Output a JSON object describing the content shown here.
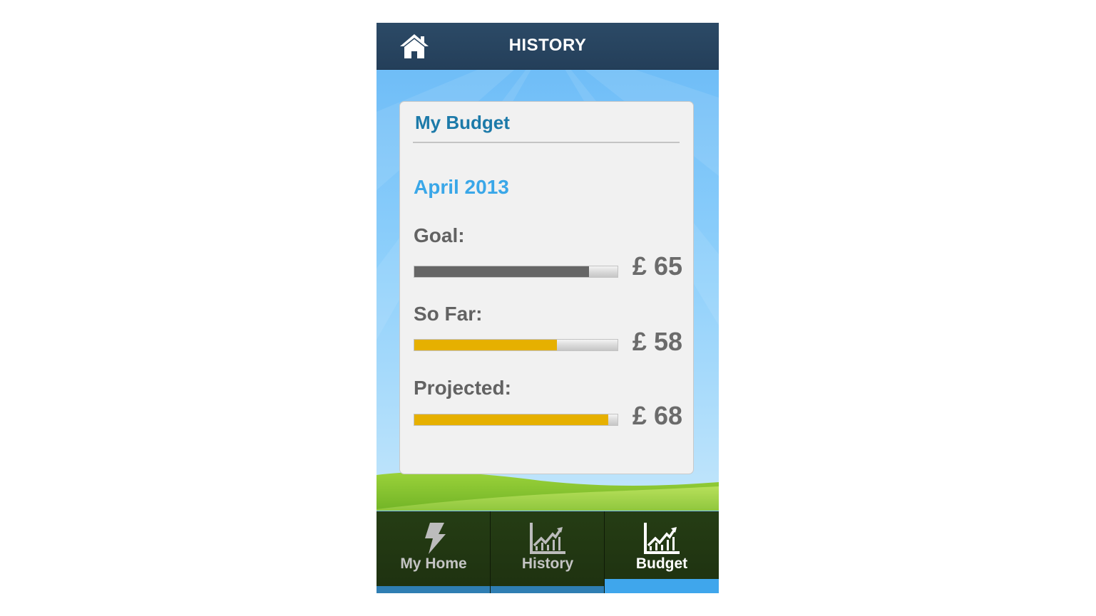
{
  "header": {
    "title": "HISTORY",
    "home_icon": "home-icon"
  },
  "card": {
    "title": "My Budget",
    "month": "April 2013",
    "rows": [
      {
        "label": "Goal:",
        "amount": "£ 65",
        "fill": 0.86,
        "color": "#666666"
      },
      {
        "label": "So Far:",
        "amount": "£ 58",
        "fill": 0.7,
        "color": "#e6b000"
      },
      {
        "label": "Projected:",
        "amount": "£ 68",
        "fill": 0.955,
        "color": "#e6b000"
      }
    ]
  },
  "nav": {
    "tabs": [
      {
        "label": "My Home",
        "icon": "lightning-icon",
        "active": false
      },
      {
        "label": "History",
        "icon": "history-chart-icon",
        "active": false
      },
      {
        "label": "Budget",
        "icon": "budget-chart-icon",
        "active": true
      }
    ]
  },
  "colors": {
    "header_bg": "#2c4a66",
    "accent_blue": "#3aa7e8",
    "tab_strip": "#2f7eb3",
    "tab_strip_active": "#3fa6ec",
    "goal_bar": "#666666",
    "progress_bar": "#e6b000"
  }
}
